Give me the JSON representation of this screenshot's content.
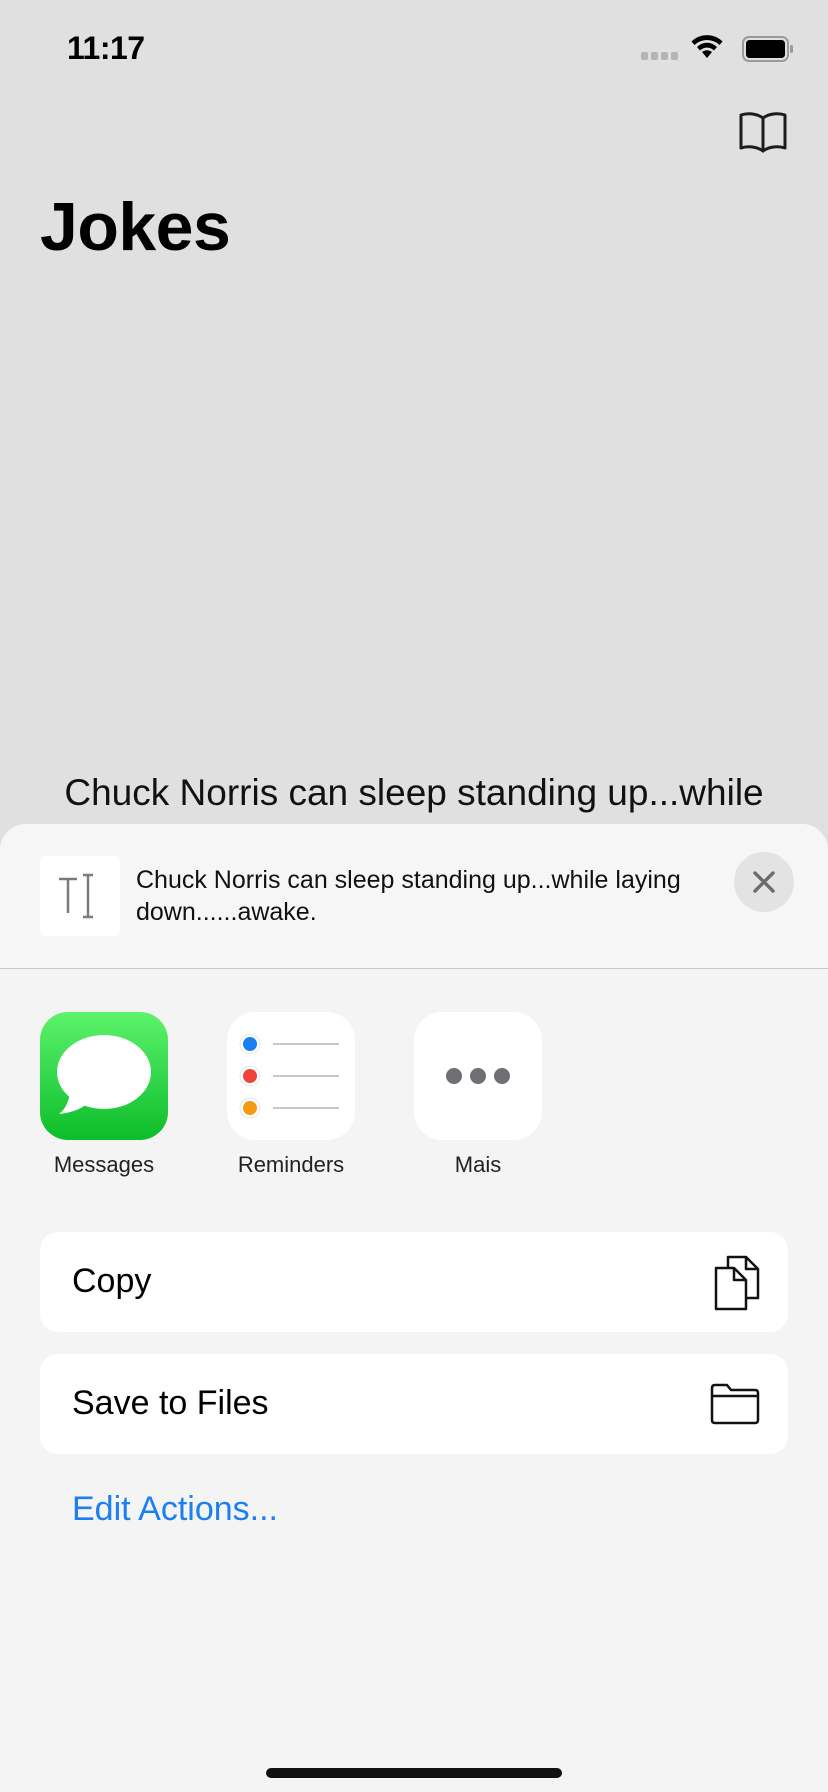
{
  "status_bar": {
    "time": "11:17"
  },
  "app": {
    "title": "Jokes",
    "joke": "Chuck Norris can sleep standing up...while"
  },
  "share_sheet": {
    "preview_text": "Chuck Norris can sleep standing up...while laying down......awake.",
    "apps": [
      {
        "label": "Messages",
        "icon": "messages-icon"
      },
      {
        "label": "Reminders",
        "icon": "reminders-icon"
      },
      {
        "label": "Mais",
        "icon": "more-icon"
      }
    ],
    "actions": [
      {
        "label": "Copy",
        "icon": "copy-icon"
      },
      {
        "label": "Save to Files",
        "icon": "folder-icon"
      }
    ],
    "edit_actions_label": "Edit Actions...",
    "accent_color": "#1a7ff0"
  }
}
